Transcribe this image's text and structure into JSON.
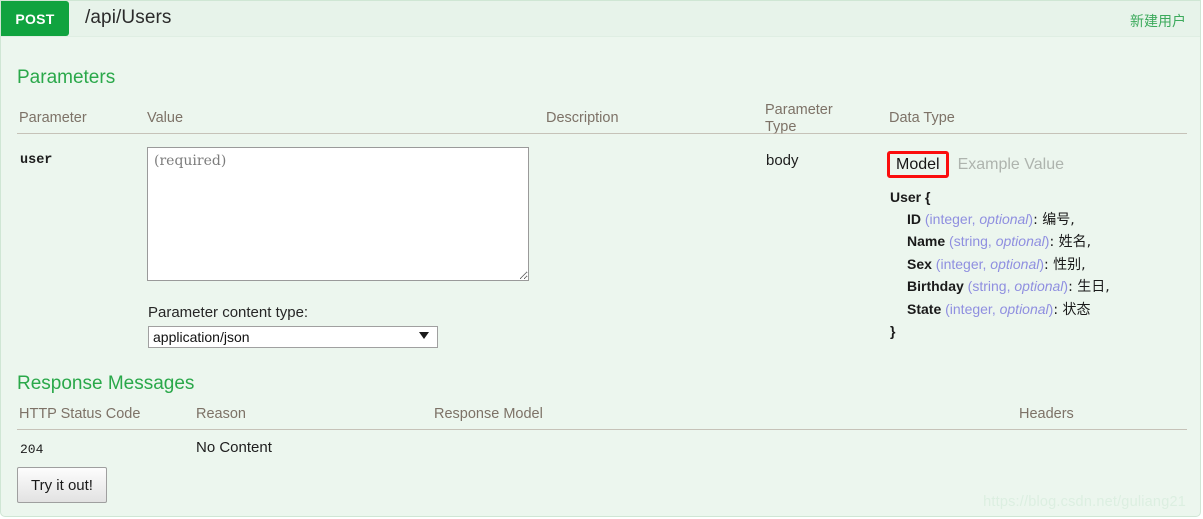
{
  "operation": {
    "method": "POST",
    "path": "/api/Users",
    "summary": "新建用户"
  },
  "parameters": {
    "section_title": "Parameters",
    "columns": {
      "parameter": "Parameter",
      "value": "Value",
      "description": "Description",
      "parameter_type_line1": "Parameter",
      "parameter_type_line2": "Type",
      "data_type": "Data Type"
    },
    "row": {
      "name": "user",
      "value_placeholder": "(required)",
      "value": "",
      "description": "",
      "parameter_type": "body"
    },
    "content_type": {
      "label": "Parameter content type:",
      "selected": "application/json",
      "options": [
        "application/json"
      ]
    }
  },
  "data_type": {
    "tabs": {
      "model": "Model",
      "example_value": "Example Value"
    },
    "active_tab": "Model",
    "highlight_color": "#fb0d0d",
    "model": {
      "open": "User {",
      "close": "}",
      "properties": [
        {
          "name": "ID",
          "type": "integer",
          "optional": "optional",
          "description": "编号",
          "trailing": ","
        },
        {
          "name": "Name",
          "type": "string",
          "optional": "optional",
          "description": "姓名",
          "trailing": ","
        },
        {
          "name": "Sex",
          "type": "integer",
          "optional": "optional",
          "description": "性别",
          "trailing": ","
        },
        {
          "name": "Birthday",
          "type": "string",
          "optional": "optional",
          "description": "生日",
          "trailing": ","
        },
        {
          "name": "State",
          "type": "integer",
          "optional": "optional",
          "description": "状态",
          "trailing": ""
        }
      ]
    }
  },
  "responses": {
    "section_title": "Response Messages",
    "columns": {
      "status_code": "HTTP Status Code",
      "reason": "Reason",
      "response_model": "Response Model",
      "headers": "Headers"
    },
    "rows": [
      {
        "code": "204",
        "reason": "No Content",
        "model": "",
        "headers": ""
      }
    ]
  },
  "submit": {
    "label": "Try it out!"
  },
  "watermark": "https://blog.csdn.net/guliang21",
  "colors": {
    "method_badge": "#10a33f",
    "section_heading": "#2aa84a",
    "background": "#ecf6ee",
    "type_blue": "#8f8fe0"
  }
}
